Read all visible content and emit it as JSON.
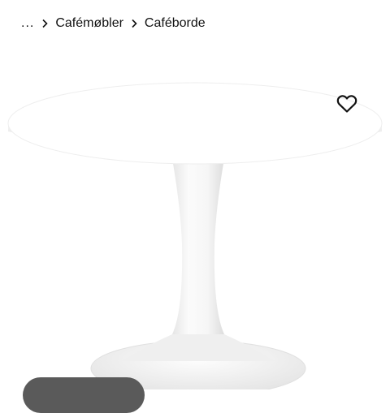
{
  "breadcrumb": {
    "ellipsis": "...",
    "items": [
      {
        "label": "Cafémøbler"
      },
      {
        "label": "Caféborde"
      }
    ]
  },
  "product": {
    "image_icon": "round-white-pedestal-table"
  },
  "favourite": {
    "icon": "heart-outline-icon"
  },
  "colors": {
    "text": "#111111",
    "background": "#ffffff",
    "pill": "#5a5a5a"
  }
}
